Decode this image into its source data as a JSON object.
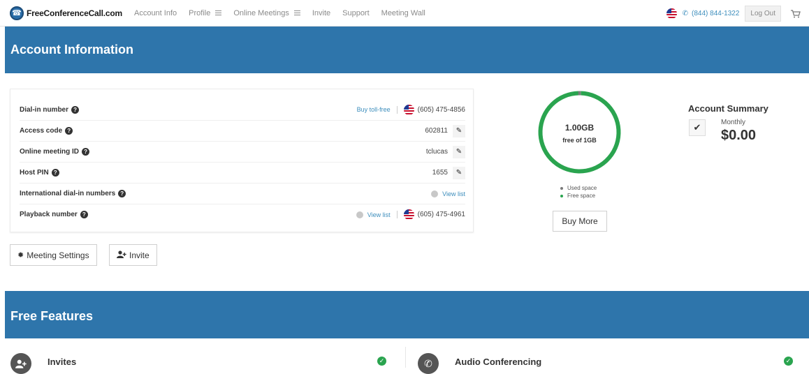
{
  "nav": {
    "logo": "FreeConferenceCall.com",
    "links": [
      "Account Info",
      "Profile",
      "Online Meetings",
      "Invite",
      "Support",
      "Meeting Wall"
    ],
    "phone": "(844) 844-1322",
    "logout": "Log Out"
  },
  "banner1": "Account Information",
  "details": {
    "rows": [
      {
        "label": "Dial-in number",
        "link": "Buy toll-free",
        "value": "(605) 475-4856"
      },
      {
        "label": "Access code",
        "value": "602811"
      },
      {
        "label": "Online meeting ID",
        "value": "tclucas"
      },
      {
        "label": "Host PIN",
        "value": "1655"
      },
      {
        "label": "International dial-in numbers",
        "link": "View list"
      },
      {
        "label": "Playback number",
        "link": "View list",
        "value": "(605) 475-4961"
      }
    ]
  },
  "buttons": {
    "meeting_settings": "Meeting Settings",
    "invite": "Invite"
  },
  "storage": {
    "amount": "1.00GB",
    "caption": "free of 1GB",
    "free_fraction": 0.99,
    "legend_used": "Used space",
    "legend_free": "Free space",
    "buy_more": "Buy More",
    "used_color": "#7a7a7a",
    "free_color": "#2aa44f"
  },
  "summary": {
    "title": "Account Summary",
    "period": "Monthly",
    "amount": "$0.00"
  },
  "banner2": "Free Features",
  "features": [
    {
      "label": "Invites",
      "icon": "add-user-icon"
    },
    {
      "label": "Audio Conferencing",
      "icon": "phone-icon"
    }
  ]
}
